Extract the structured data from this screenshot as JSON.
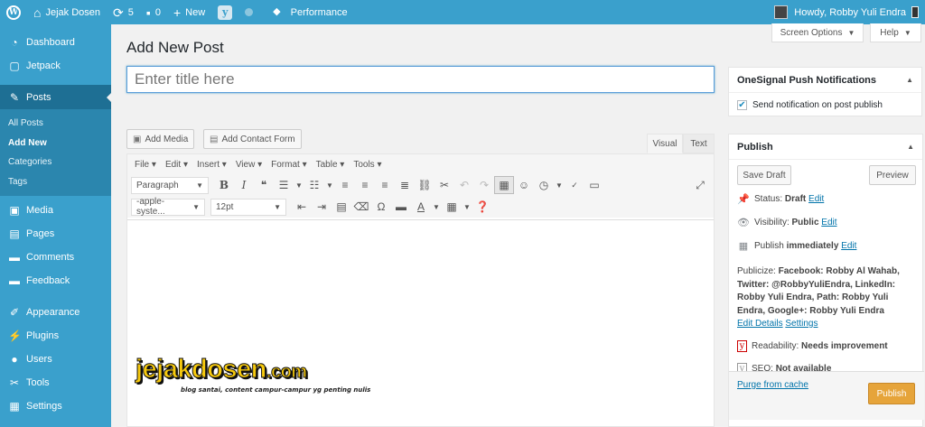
{
  "adminbar": {
    "site_name": "Jejak Dosen",
    "updates_count": "5",
    "comments_count": "0",
    "new_label": "New",
    "performance_label": "Performance",
    "howdy": "Howdy, Robby Yuli Endra"
  },
  "sidebar": {
    "items": [
      {
        "label": "Dashboard",
        "icon": "dashboard-icon"
      },
      {
        "label": "Jetpack",
        "icon": "jetpack-icon"
      },
      {
        "label": "Posts",
        "icon": "pin-icon"
      },
      {
        "label": "Media",
        "icon": "media-icon"
      },
      {
        "label": "Pages",
        "icon": "pages-icon"
      },
      {
        "label": "Comments",
        "icon": "comments-icon"
      },
      {
        "label": "Feedback",
        "icon": "feedback-icon"
      },
      {
        "label": "Appearance",
        "icon": "brush-icon"
      },
      {
        "label": "Plugins",
        "icon": "plugin-icon"
      },
      {
        "label": "Users",
        "icon": "users-icon"
      },
      {
        "label": "Tools",
        "icon": "wrench-icon"
      },
      {
        "label": "Settings",
        "icon": "settings-icon"
      }
    ],
    "posts_sub": [
      "All Posts",
      "Add New",
      "Categories",
      "Tags"
    ]
  },
  "screen_options": "Screen Options",
  "help": "Help",
  "page_title": "Add New Post",
  "title_placeholder": "Enter title here",
  "media_buttons": {
    "add_media": "Add Media",
    "add_contact_form": "Add Contact Form"
  },
  "editor_tabs": {
    "visual": "Visual",
    "text": "Text"
  },
  "menubar": [
    "File",
    "Edit",
    "Insert",
    "View",
    "Format",
    "Table",
    "Tools"
  ],
  "toolbar": {
    "format_select": "Paragraph",
    "font_family": "-apple-syste...",
    "font_size": "12pt"
  },
  "content_logo": {
    "name_main": "jejakdosen",
    "name_suffix": ".com",
    "tagline": "blog santai, content campur-campur yg penting nulis"
  },
  "onesignal": {
    "title": "OneSignal Push Notifications",
    "checkbox_label": "Send notification on post publish",
    "checked": true
  },
  "publish": {
    "title": "Publish",
    "save_draft": "Save Draft",
    "preview": "Preview",
    "status_label": "Status:",
    "status_value": "Draft",
    "visibility_label": "Visibility:",
    "visibility_value": "Public",
    "publish_label": "Publish",
    "publish_value": "immediately",
    "edit": "Edit",
    "publicize_label": "Publicize:",
    "publicize_text": "Facebook: Robby Al Wahab, Twitter: @RobbyYuliEndra, LinkedIn: Robby Yuli Endra, Path: Robby Yuli Endra, Google+: Robby Yuli Endra",
    "edit_details": "Edit Details",
    "settings": "Settings",
    "readability_label": "Readability:",
    "readability_value": "Needs improvement",
    "seo_label": "SEO:",
    "seo_value": "Not available",
    "purge": "Purge from cache",
    "publish_button": "Publish"
  }
}
